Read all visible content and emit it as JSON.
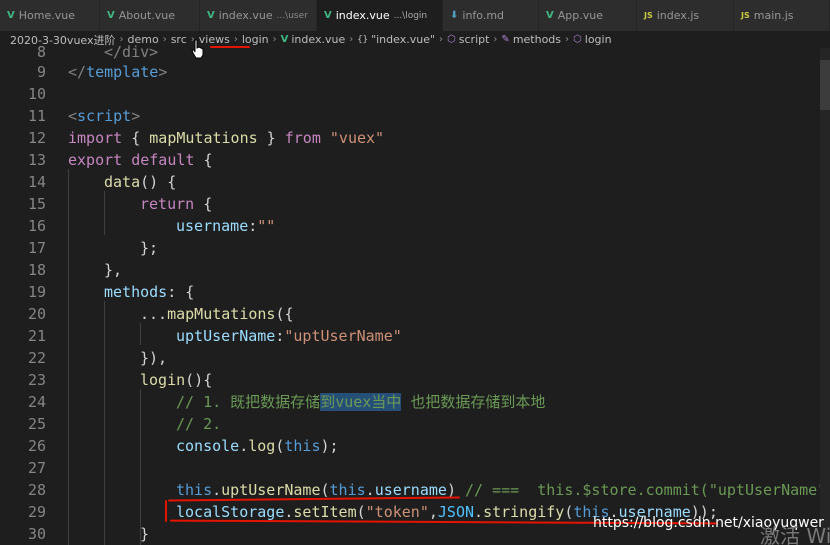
{
  "tabs": [
    {
      "label": "Home.vue",
      "icon": "vue-icon",
      "glyph": "V"
    },
    {
      "label": "About.vue",
      "icon": "vue-icon",
      "glyph": "V"
    },
    {
      "label": "index.vue",
      "hint": "...\\user",
      "icon": "vue-icon",
      "glyph": "V"
    },
    {
      "label": "index.vue",
      "hint": "...\\login",
      "icon": "vue-icon",
      "glyph": "V",
      "active": true,
      "modified": true
    },
    {
      "label": "info.md",
      "icon": "markdown-icon",
      "glyph": "⬇"
    },
    {
      "label": "App.vue",
      "icon": "vue-icon",
      "glyph": "V"
    },
    {
      "label": "index.js",
      "icon": "js-icon",
      "glyph": "JS"
    },
    {
      "label": "main.js",
      "icon": "js-icon",
      "glyph": "JS"
    }
  ],
  "breadcrumb": {
    "items": [
      "2020-3-30vuex进阶",
      "demo",
      "src",
      "views",
      "login"
    ],
    "file": "index.vue",
    "braces": "{}",
    "object": "\"index.vue\"",
    "script": "script",
    "methods": "methods",
    "login": "login"
  },
  "gutter": [
    "8",
    "9",
    "10",
    "11",
    "12",
    "13",
    "14",
    "15",
    "16",
    "17",
    "18",
    "19",
    "20",
    "21",
    "22",
    "23",
    "24",
    "25",
    "26",
    "27",
    "28",
    "29",
    "30"
  ],
  "code": {
    "l8": "</div>",
    "l9_open": "</",
    "l9_tag": "template",
    "l9_close": ">",
    "l11_open": "<",
    "l11_tag": "script",
    "l11_close": ">",
    "l12_import": "import",
    "l12_a": " { ",
    "l12_fn": "mapMutations",
    "l12_b": " } ",
    "l12_from": "from",
    "l12_sp": " ",
    "l12_str": "\"vuex\"",
    "l13_export": "export",
    "l13_sp": " ",
    "l13_default": "default",
    "l13_rest": " {",
    "l14_fn": "data",
    "l14_rest": "() {",
    "l15_return": "return",
    "l15_rest": " {",
    "l16_prop": "username",
    "l16_colon": ":",
    "l16_str": "\"\"",
    "l17": "};",
    "l18": "},",
    "l19_prop": "methods",
    "l19_rest": ": {",
    "l20_dots": "...",
    "l20_fn": "mapMutations",
    "l20_rest": "({",
    "l21_prop": "uptUserName",
    "l21_colon": ":",
    "l21_str": "\"uptUserName\"",
    "l22": "}),",
    "l23_fn": "login",
    "l23_rest": "(){",
    "l24_a": "// 1. 既把数据存储",
    "l24_sel": "到vuex当中",
    "l24_b": " 也把数据存储到本地",
    "l25": "// 2.",
    "l26_obj": "console",
    "l26_dot": ".",
    "l26_fn": "log",
    "l26_open": "(",
    "l26_this": "this",
    "l26_close": ");",
    "l28_this": "this",
    "l28_dot": ".",
    "l28_fn": "uptUserName",
    "l28_open": "(",
    "l28_this2": "this",
    "l28_dot2": ".",
    "l28_prop": "username",
    "l28_close": ") ",
    "l28_cm": "// ===  this.$store.commit(\"uptUserName\"",
    "l29_obj": "localStorage",
    "l29_dot": ".",
    "l29_fn": "setItem",
    "l29_open": "(",
    "l29_str": "\"token\"",
    "l29_comma": ",",
    "l29_json": "JSON",
    "l29_dot2": ".",
    "l29_fn2": "stringify",
    "l29_open2": "(",
    "l29_this": "this",
    "l29_dot3": ".",
    "l29_prop": "username",
    "l29_close": "));",
    "l30": "}"
  },
  "watermark": "https://blog.csdn.net/xiaoyuqwer",
  "activate": "激活 Wi",
  "colors": {
    "vue": "#41b883",
    "js": "#cbcb41",
    "keyword": "#c586c0",
    "string": "#ce9178",
    "annotation": "#e51400"
  }
}
